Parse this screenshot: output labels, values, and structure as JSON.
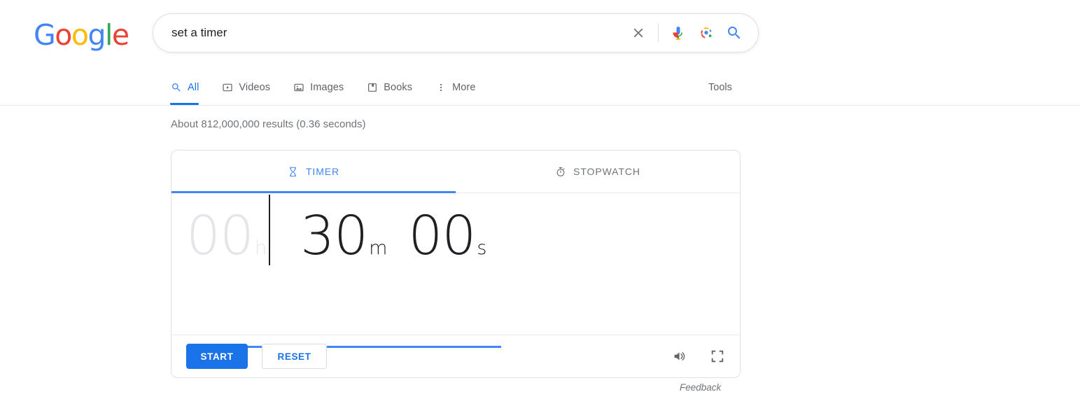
{
  "header": {
    "logo": {
      "name": "Google",
      "letters": [
        {
          "char": "G",
          "color": "#4285F4"
        },
        {
          "char": "o",
          "color": "#EA4335"
        },
        {
          "char": "o",
          "color": "#FBBC05"
        },
        {
          "char": "g",
          "color": "#4285F4"
        },
        {
          "char": "l",
          "color": "#34A853"
        },
        {
          "char": "e",
          "color": "#EA4335"
        }
      ]
    },
    "search": {
      "value": "set a timer",
      "placeholder": "Search",
      "clear_icon": "close-icon",
      "voice_icon": "microphone-icon",
      "lens_icon": "google-lens-icon",
      "submit_icon": "search-icon"
    }
  },
  "nav": {
    "tabs": [
      {
        "label": "All",
        "icon": "search-icon",
        "active": true
      },
      {
        "label": "Videos",
        "icon": "video-icon",
        "active": false
      },
      {
        "label": "Images",
        "icon": "image-icon",
        "active": false
      },
      {
        "label": "Books",
        "icon": "book-icon",
        "active": false
      },
      {
        "label": "More",
        "icon": "more-vertical-icon",
        "active": false
      }
    ],
    "tools_label": "Tools"
  },
  "results": {
    "stats": "About 812,000,000 results (0.36 seconds)"
  },
  "timer_card": {
    "tabs": [
      {
        "label": "TIMER",
        "icon": "hourglass-icon",
        "active": true
      },
      {
        "label": "STOPWATCH",
        "icon": "stopwatch-icon",
        "active": false
      }
    ],
    "display": {
      "hours": {
        "value": "00",
        "unit": "h"
      },
      "minutes": {
        "value": "30",
        "unit": "m"
      },
      "seconds": {
        "value": "00",
        "unit": "s"
      }
    },
    "buttons": {
      "start": "START",
      "reset": "RESET"
    },
    "icons": {
      "sound": "volume-icon",
      "fullscreen": "fullscreen-icon"
    },
    "colors": {
      "accent": "#4285f4",
      "start_button": "#1a73e8",
      "inactive_digits": "#e3e5e8",
      "active_digits": "#202124"
    }
  },
  "feedback": {
    "label": "Feedback"
  }
}
